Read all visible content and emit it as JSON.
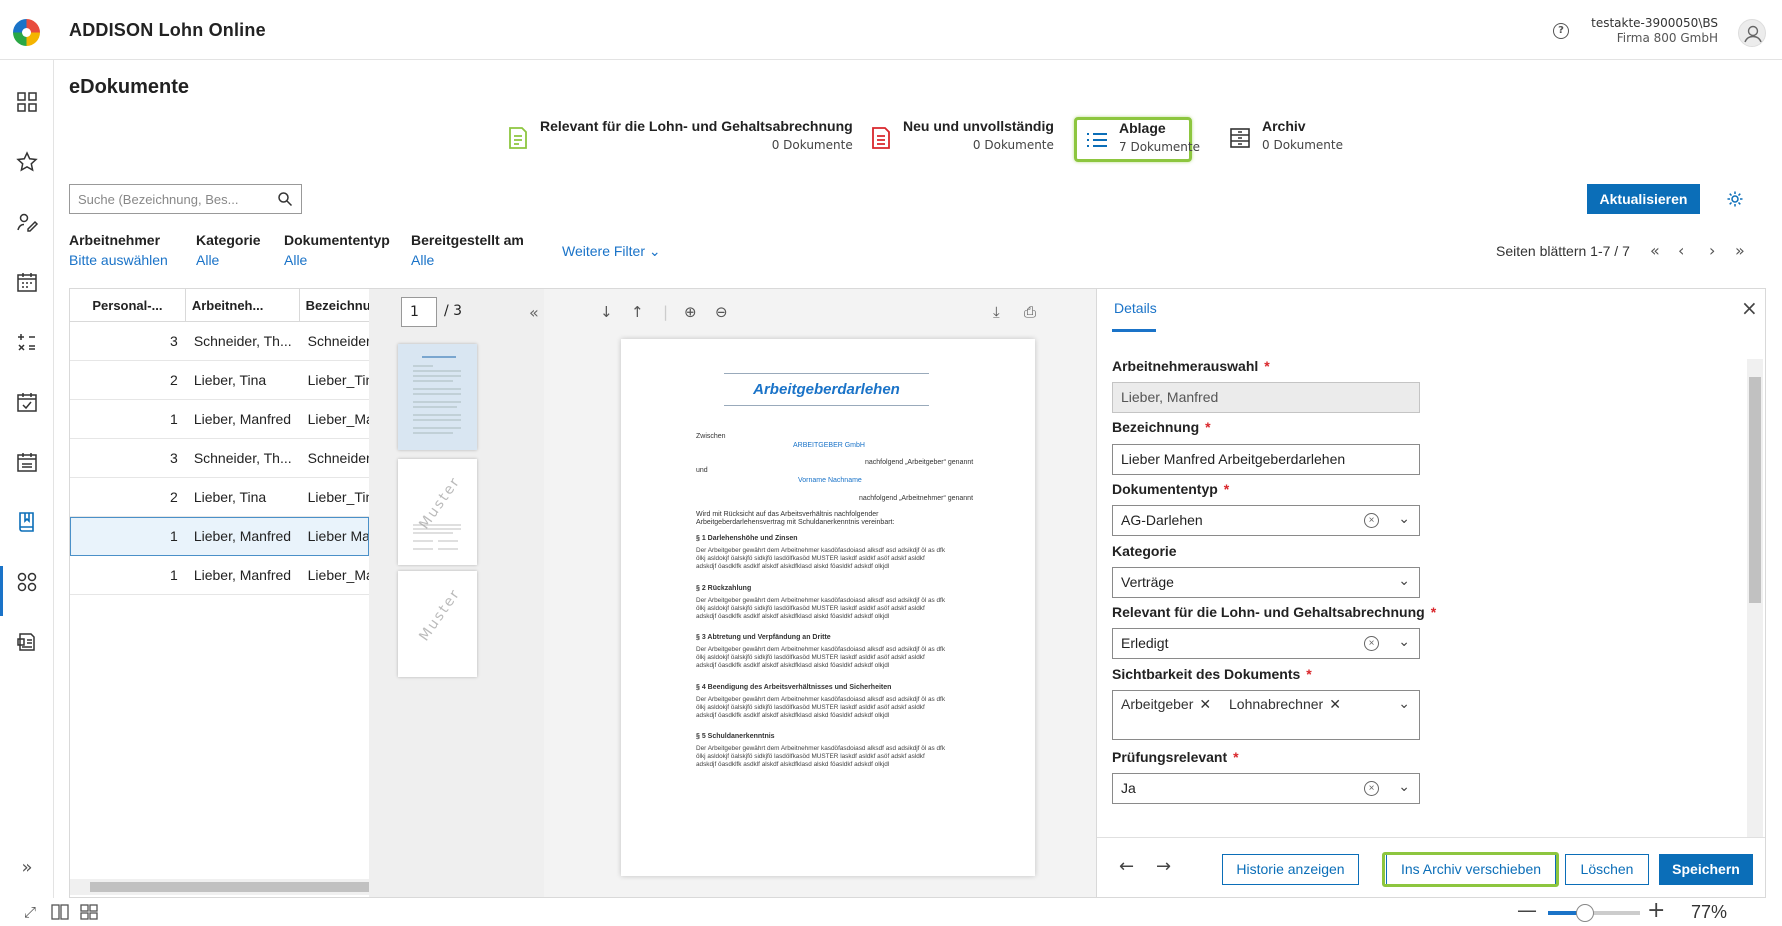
{
  "header": {
    "app_title": "ADDISON Lohn Online",
    "user_line1": "testakte-3900050\\BS",
    "user_line2": "Firma 800 GmbH",
    "help_glyph": "?"
  },
  "page": {
    "title": "eDokumente"
  },
  "categories": [
    {
      "title": "Relevant für die Lohn- und Gehaltsabrechnung",
      "count": "0 Dokumente",
      "icon": "document-list-icon",
      "color": "#8dc63f"
    },
    {
      "title": "Neu und unvollständig",
      "count": "0 Dokumente",
      "icon": "document-alert-icon",
      "color": "#d9262b"
    },
    {
      "title": "Ablage",
      "count": "7 Dokumente",
      "icon": "list-icon",
      "color": "#0b6eb8"
    },
    {
      "title": "Archiv",
      "count": "0 Dokumente",
      "icon": "archive-icon",
      "color": "#333333"
    }
  ],
  "search": {
    "placeholder": "Suche (Bezeichnung, Bes..."
  },
  "toolbar": {
    "refresh_label": "Aktualisieren"
  },
  "filters": [
    {
      "label": "Arbeitnehmer",
      "value": "Bitte auswählen"
    },
    {
      "label": "Kategorie",
      "value": "Alle"
    },
    {
      "label": "Dokumententyp",
      "value": "Alle"
    },
    {
      "label": "Bereitgestellt am",
      "value": "Alle"
    }
  ],
  "more_filters": "Weitere Filter",
  "paging": {
    "text": "Seiten blättern 1-7 / 7"
  },
  "table": {
    "columns": [
      "Personal-...",
      "Arbeitneh...",
      "Bezeichnu"
    ],
    "rows": [
      [
        "3",
        "Schneider, Th...",
        "Schneider"
      ],
      [
        "2",
        "Lieber, Tina",
        "Lieber_Tin"
      ],
      [
        "1",
        "Lieber, Manfred",
        "Lieber_Ma"
      ],
      [
        "3",
        "Schneider, Th...",
        "Schneider"
      ],
      [
        "2",
        "Lieber, Tina",
        "Lieber_Tin"
      ],
      [
        "1",
        "Lieber, Manfred",
        "Lieber Ma"
      ],
      [
        "1",
        "Lieber, Manfred",
        "Lieber_Ma"
      ]
    ],
    "selected_index": 5
  },
  "viewer": {
    "page_input": "1",
    "page_total": "/ 3",
    "watermark": "Muster",
    "doc": {
      "title": "Arbeitgeberdarlehen",
      "zwischen": "Zwischen",
      "employer": "ARBEITGEBER GmbH",
      "employer_note": "nachfolgend „Arbeitgeber“ genannt",
      "und": "und",
      "employee": "Vorname Nachname",
      "employee_note": "nachfolgend „Arbeitnehmer“ genannt",
      "intro1": "Wird mit Rücksicht auf das Arbeitsverhältnis nachfolgender",
      "intro2": "Arbeitgeberdarlehensvertrag mit Schuldanerkenntnis vereinbart:",
      "sections": [
        "§ 1 Darlehenshöhe und Zinsen",
        "§ 2 Rückzahlung",
        "§ 3 Abtretung und Verpfändung an Dritte",
        "§ 4 Beendigung des Arbeitsverhältnisses und Sicherheiten",
        "§ 5 Schuldanerkenntnis"
      ],
      "para1": "Der Arbeitgeber gewährt dem Arbeitnehmer kasdöfasdoiasd alksdf asd adsikdjf öl as dfk",
      "para2": "ölkj asldokjf öalskjfö sidkjfö lasdölfkasöd MUSTER laskdf asldkf asöf adskf asldkf",
      "para3": "adskdjf öasdklfk asdklf alskdf alskdfklasd alskd föasldkf adskdf olkjdl"
    }
  },
  "details": {
    "tab": "Details",
    "fields": {
      "arbeitnehmer_label": "Arbeitnehmerauswahl",
      "arbeitnehmer_value": "Lieber, Manfred",
      "bezeichnung_label": "Bezeichnung",
      "bezeichnung_value": "Lieber Manfred Arbeitgeberdarlehen",
      "dokumententyp_label": "Dokumententyp",
      "dokumententyp_value": "AG-Darlehen",
      "kategorie_label": "Kategorie",
      "kategorie_value": "Verträge",
      "relevant_label": "Relevant für die Lohn- und Gehaltsabrechnung",
      "relevant_value": "Erledigt",
      "sichtbarkeit_label": "Sichtbarkeit des Dokuments",
      "sichtbarkeit_chips": [
        "Arbeitgeber",
        "Lohnabrechner"
      ],
      "pruefung_label": "Prüfungsrelevant",
      "pruefung_value": "Ja"
    },
    "buttons": {
      "history": "Historie anzeigen",
      "archive": "Ins Archiv verschieben",
      "delete": "Löschen",
      "save": "Speichern"
    }
  },
  "zoom": {
    "level": "77%",
    "fraction": 0.4
  },
  "colors": {
    "accent": "#0b6eb8",
    "highlight": "#8dc63f",
    "required": "#d9262b"
  }
}
